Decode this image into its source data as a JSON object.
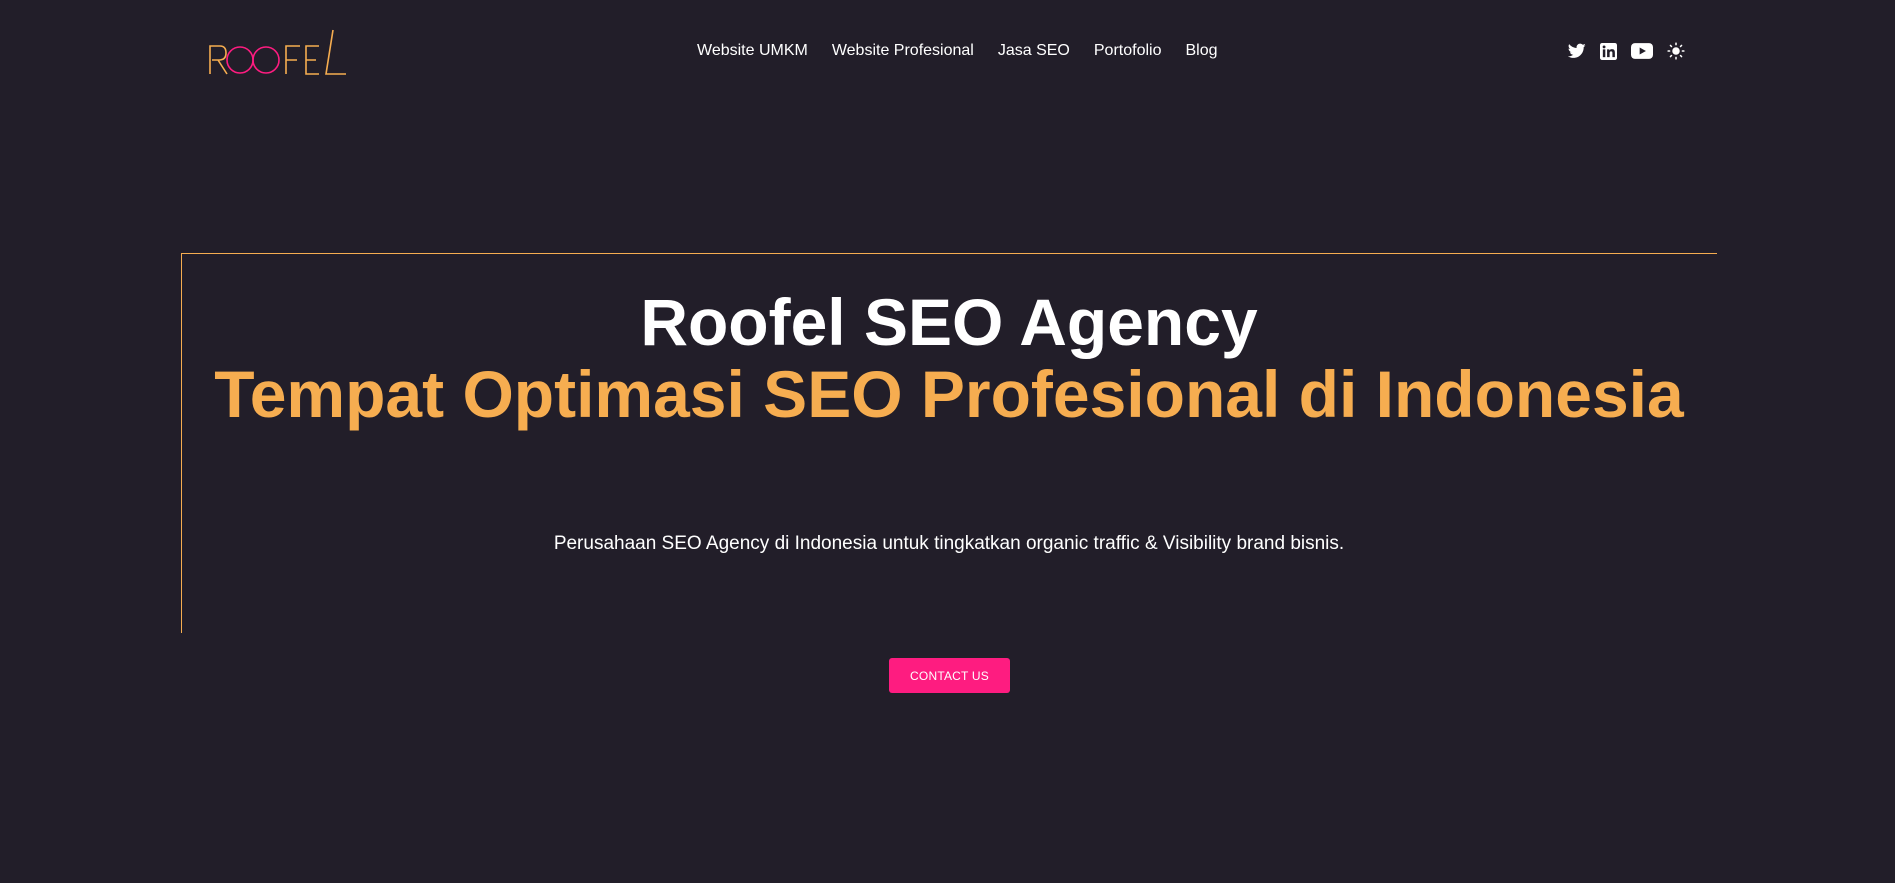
{
  "brand": {
    "logo_text": "ROOFEL",
    "colors": {
      "background": "#221e29",
      "accent_orange": "#f6ad50",
      "accent_pink": "#fe1c80",
      "text": "#ffffff"
    }
  },
  "nav": {
    "items": [
      {
        "label": "Website UMKM"
      },
      {
        "label": "Website Profesional"
      },
      {
        "label": "Jasa SEO"
      },
      {
        "label": "Portofolio"
      },
      {
        "label": "Blog"
      }
    ]
  },
  "header_icons": [
    "twitter-icon",
    "linkedin-icon",
    "youtube-icon",
    "sun-icon"
  ],
  "hero": {
    "title_line1": "Roofel SEO Agency",
    "title_line2": "Tempat Optimasi SEO Profesional di Indonesia",
    "subtitle": "Perusahaan SEO Agency di Indonesia untuk tingkatkan organic traffic & Visibility brand bisnis.",
    "cta_label": "CONTACT US"
  }
}
